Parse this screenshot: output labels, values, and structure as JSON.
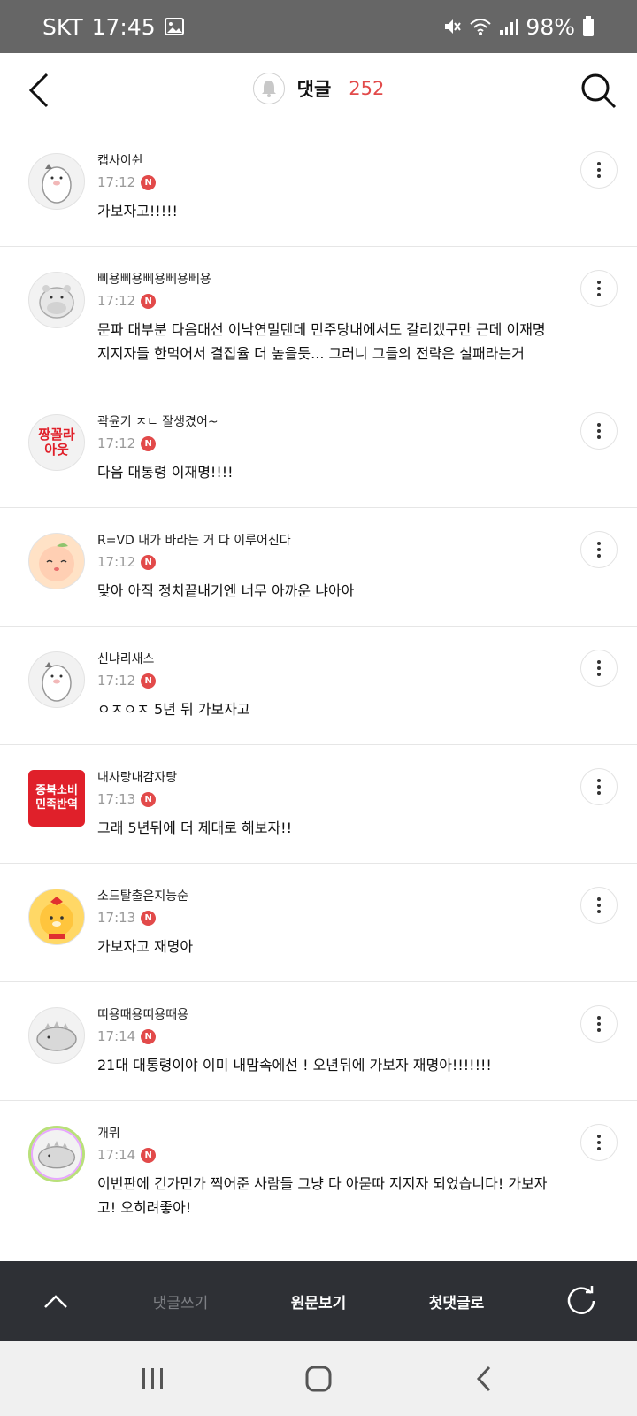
{
  "status_bar": {
    "carrier": "SKT",
    "time": "17:45",
    "battery": "98%"
  },
  "header": {
    "title": "댓글",
    "count": "252"
  },
  "comments": [
    {
      "nickname": "캡사이쉰",
      "time": "17:12",
      "badge": "N",
      "text": "가보자고!!!!!",
      "avatar": "white-bear"
    },
    {
      "nickname": "삐용삐용삐용삐용삐용",
      "time": "17:12",
      "badge": "N",
      "text": "문파 대부분 다음대선 이낙연밀텐데 민주당내에서도 갈리겠구만 근데 이재명지지자들 한먹어서 결집율 더 높을듯... 그러니 그들의 전략은 실패라는거",
      "avatar": "hippo"
    },
    {
      "nickname": "곽윤기 ㅈㄴ 잘생겼어~",
      "time": "17:12",
      "badge": "N",
      "text": "다음 대통령 이재명!!!!",
      "avatar_text": "짱꼴라\n아웃"
    },
    {
      "nickname": "R=VD 내가 바라는 거 다 이루어진다",
      "time": "17:12",
      "badge": "N",
      "text": "맞아 아직 정치끝내기엔 너무 아까운 냐아아",
      "avatar": "peach"
    },
    {
      "nickname": "신냐리새스",
      "time": "17:12",
      "badge": "N",
      "text": "ㅇㅈㅇㅈ 5년 뒤 가보자고",
      "avatar": "white-bear"
    },
    {
      "nickname": "내사랑내감자탕",
      "time": "17:13",
      "badge": "N",
      "text": "그래 5년뒤에 더 제대로 해보자!!",
      "avatar_text": "종북소비\n민족반역"
    },
    {
      "nickname": "소드탈출은지능순",
      "time": "17:13",
      "badge": "N",
      "text": "가보자고 재명아",
      "avatar": "lion"
    },
    {
      "nickname": "띠용때용띠용때용",
      "time": "17:14",
      "badge": "N",
      "text": "21대 대통령이야 이미 내맘속에선 ! 오년뒤에 가보자 재명아!!!!!!!",
      "avatar": "dino"
    },
    {
      "nickname": "개뮈",
      "time": "17:14",
      "badge": "N",
      "text": "이번판에 긴가민가 찍어준 사람들 그냥 다 아묻따 지지자 되었습니다! 가보자고! 오히려좋아!",
      "avatar": "dino-ring"
    }
  ],
  "toolbar": {
    "write_label": "댓글쓰기",
    "original_label": "원문보기",
    "first_label": "첫댓글로"
  },
  "colors": {
    "accent": "#e24a4a",
    "toolbar_bg": "#2e3035",
    "status_bg": "#666666"
  }
}
